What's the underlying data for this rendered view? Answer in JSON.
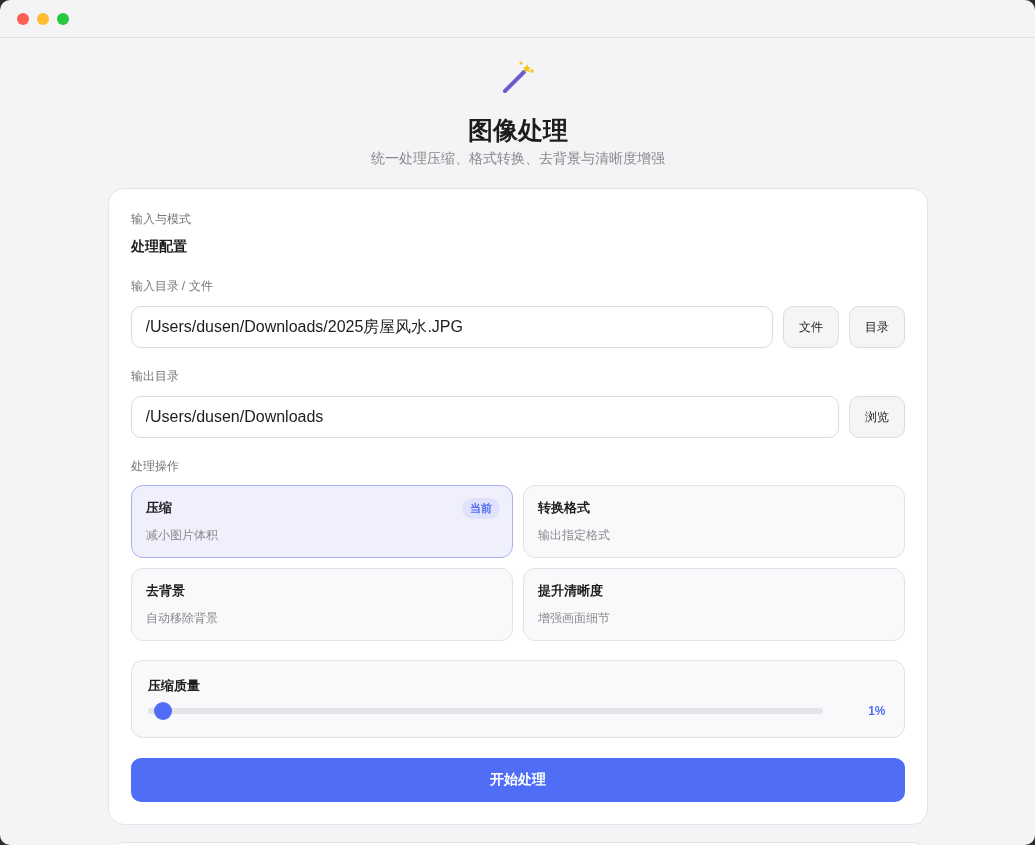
{
  "window": {
    "controls": [
      {
        "kind": "close",
        "color": "#ff5f57"
      },
      {
        "kind": "minimize",
        "color": "#febc2e"
      },
      {
        "kind": "zoom",
        "color": "#28c840"
      }
    ]
  },
  "header": {
    "title": "图像处理",
    "subtitle": "统一处理压缩、格式转换、去背景与清晰度增强"
  },
  "config": {
    "eyebrow": "输入与模式",
    "title": "处理配置",
    "input": {
      "label": "输入目录 / 文件",
      "value": "/Users/dusen/Downloads/2025房屋风水.JPG",
      "buttons": [
        "文件",
        "目录"
      ]
    },
    "output": {
      "label": "输出目录",
      "value": "/Users/dusen/Downloads",
      "buttons": [
        "浏览"
      ]
    },
    "operations_label": "处理操作",
    "operations": [
      {
        "title": "压缩",
        "description": "减小图片体积",
        "selected": true,
        "badge": "当前"
      },
      {
        "title": "转换格式",
        "description": "输出指定格式",
        "selected": false
      },
      {
        "title": "去背景",
        "description": "自动移除背景",
        "selected": false
      },
      {
        "title": "提升清晰度",
        "description": "增强画面细节",
        "selected": false
      }
    ],
    "quality": {
      "label": "压缩质量",
      "level": 0.01,
      "reading": "1%"
    },
    "start_button": "开始处理"
  }
}
